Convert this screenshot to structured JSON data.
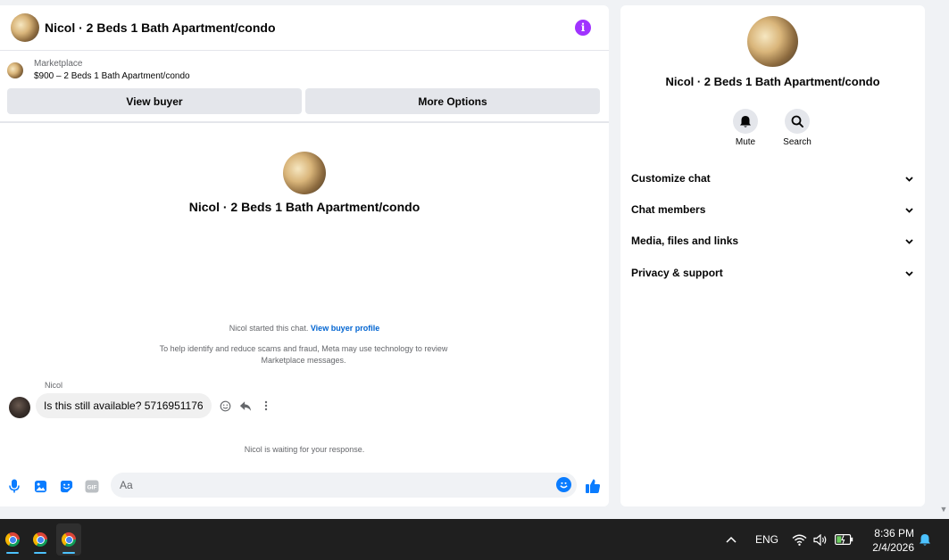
{
  "chat": {
    "title": "Nicol · 2 Beds 1 Bath Apartment/condo",
    "marketplace_label": "Marketplace",
    "listing": "$900 – 2 Beds 1 Bath Apartment/condo",
    "view_buyer_label": "View buyer",
    "more_options_label": "More Options",
    "intro_title": "Nicol · 2 Beds 1 Bath Apartment/condo",
    "started_text": "Nicol started this chat.",
    "view_buyer_profile_link": "View buyer profile",
    "scam_notice": "To help identify and reduce scams and fraud, Meta may use technology to review Marketplace messages.",
    "sender_name": "Nicol",
    "message": "Is this still available? 5716951176",
    "waiting_text": "Nicol is waiting for your response.",
    "composer_placeholder": "Aa"
  },
  "info": {
    "title": "Nicol · 2 Beds 1 Bath Apartment/condo",
    "mute_label": "Mute",
    "search_label": "Search",
    "sections": [
      {
        "label": "Customize chat"
      },
      {
        "label": "Chat members"
      },
      {
        "label": "Media, files and links"
      },
      {
        "label": "Privacy & support"
      }
    ]
  },
  "taskbar": {
    "language": "ENG",
    "time": "8:36 PM",
    "date": "2/4/2026",
    "apps": [
      "chrome-icon",
      "chrome-icon",
      "chrome-icon"
    ]
  },
  "colors": {
    "accent": "#0a7cff",
    "info_button": "#a033ff",
    "link": "#0064d1",
    "taskbar": "#1f1f1f"
  }
}
